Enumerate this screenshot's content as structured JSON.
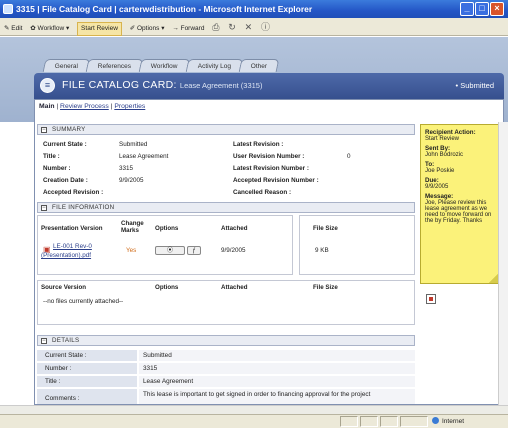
{
  "window": {
    "title": "3315 | File Catalog Card | carterwdistribution - Microsoft Internet Explorer"
  },
  "toolbar": {
    "edit": "Edit",
    "workflow": "Workflow ▾",
    "start_review": "Start Review",
    "options": "Options ▾",
    "forward": "Forward"
  },
  "tabs": [
    "General",
    "References",
    "Workflow",
    "Activity Log",
    "Other"
  ],
  "card": {
    "title": "FILE CATALOG CARD:",
    "subtitle": "Lease Agreement (3315)",
    "state": "• Submitted"
  },
  "subnav": {
    "main": "Main",
    "sep1": "|",
    "review_process": "Review Process",
    "sep2": "|",
    "properties": "Properties"
  },
  "summary": {
    "heading": "SUMMARY",
    "current_state_label": "Current State :",
    "current_state_value": "Submitted",
    "title_label": "Title :",
    "title_value": "Lease Agreement",
    "number_label": "Number :",
    "number_value": "3315",
    "creation_date_label": "Creation Date :",
    "creation_date_value": "9/9/2005",
    "accepted_revision_label": "Accepted Revision :",
    "latest_revision_label": "Latest Revision :",
    "user_revision_label": "User Revision Number :",
    "user_revision_value": "0",
    "latest_revision_number_label": "Latest Revision Number :",
    "accepted_revision_number_label": "Accepted Revision Number :",
    "cancelled_reason_label": "Cancelled Reason :"
  },
  "file_info": {
    "heading": "FILE INFORMATION",
    "cols": [
      "Presentation Version",
      "Change Marks",
      "Options",
      "Attached",
      "File Size"
    ],
    "row": {
      "file_link_line1": "LE-001 Rev-0",
      "file_link_line2": "(Presentation).pdf",
      "change_marks": "Yes",
      "attached": "9/9/2005",
      "file_size": "9 KB"
    },
    "source_cols": [
      "Source Version",
      "Options",
      "Attached",
      "File Size"
    ],
    "no_files": "--no files currently attached--"
  },
  "details": {
    "heading": "DETAILS",
    "rows": [
      {
        "k": "Current State :",
        "v": "Submitted"
      },
      {
        "k": "Number :",
        "v": "3315"
      },
      {
        "k": "Title :",
        "v": "Lease Agreement"
      },
      {
        "k": "Comments :",
        "v": "This lease is important to get signed in order to financing approval for the project"
      }
    ]
  },
  "sticky": {
    "recipient_action_label": "Recipient Action:",
    "recipient_action_value": "Start Review",
    "sent_by_label": "Sent By:",
    "sent_by_value": "John Bodrozic",
    "to_label": "To:",
    "to_value": "Joe Poskie",
    "due_label": "Due:",
    "due_value": "9/9/2005",
    "message_label": "Message:",
    "message_value": "Joe, Please review this lease agreement as we need to move forward on the by Friday. Thanks"
  },
  "status": {
    "zone": "Internet"
  }
}
